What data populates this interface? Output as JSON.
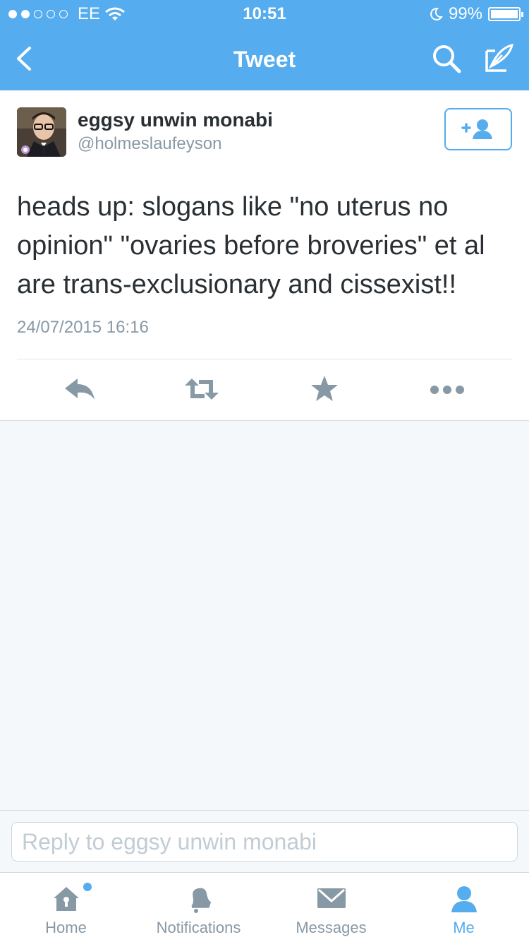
{
  "status_bar": {
    "carrier": "EE",
    "time": "10:51",
    "battery": "99%"
  },
  "nav": {
    "title": "Tweet"
  },
  "tweet": {
    "author_name": "eggsy unwin monabi",
    "author_handle": "@holmeslaufeyson",
    "text": "heads up: slogans like \"no uterus no opinion\" \"ovaries before broveries\" et al are trans-exclusionary and cissexist!!",
    "timestamp": "24/07/2015 16:16"
  },
  "reply": {
    "placeholder": "Reply to eggsy unwin monabi"
  },
  "tabs": [
    {
      "label": "Home",
      "icon": "home-icon"
    },
    {
      "label": "Notifications",
      "icon": "bell-icon"
    },
    {
      "label": "Messages",
      "icon": "envelope-icon"
    },
    {
      "label": "Me",
      "icon": "person-icon"
    }
  ],
  "colors": {
    "accent": "#55acee",
    "text": "#292f33",
    "secondary": "#8899a6"
  }
}
